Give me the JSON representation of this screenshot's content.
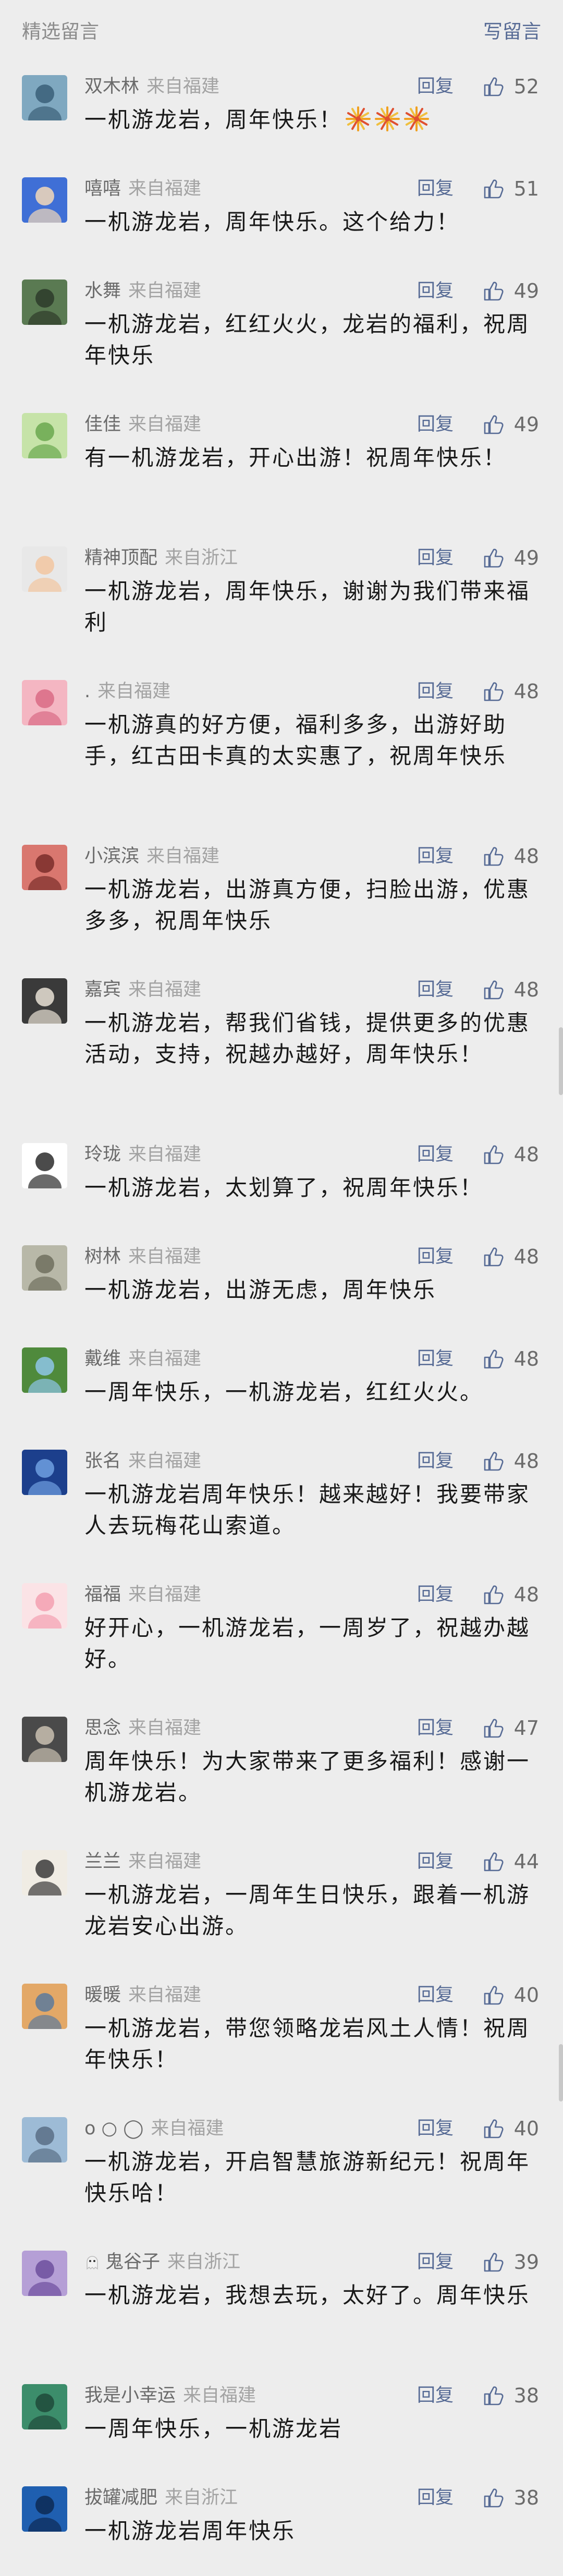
{
  "header": {
    "title": "精选留言",
    "write_label": "写留言"
  },
  "reply_label": "回复",
  "comments": [
    {
      "name": "双木林",
      "location": "来自福建",
      "text": "一机游龙岩，周年快乐！",
      "emoji": "fireworks-emoji x3",
      "likes": "52",
      "avatar_colors": [
        "#7fa8c0",
        "#3a5f78"
      ]
    },
    {
      "name": "嘻嘻",
      "location": "来自福建",
      "text": "一机游龙岩，周年快乐。这个给力！",
      "likes": "51",
      "avatar_colors": [
        "#3f6fd6",
        "#f3d9b8"
      ]
    },
    {
      "name": "水舞",
      "location": "来自福建",
      "text": "一机游龙岩，红红火火，龙岩的福利，祝周年快乐",
      "likes": "49",
      "avatar_colors": [
        "#5a7a52",
        "#2d3b2a"
      ]
    },
    {
      "name": "佳佳",
      "location": "来自福建",
      "text": "有一机游龙岩，开心出游！祝周年快乐！",
      "likes": "49",
      "avatar_colors": [
        "#c6e3a8",
        "#6aa84f"
      ]
    },
    {
      "name": "精神顶配",
      "location": "来自浙江",
      "text": "一机游龙岩，周年快乐，谢谢为我们带来福利",
      "likes": "49",
      "avatar_colors": [
        "#e8e8e8",
        "#f2c6a0"
      ]
    },
    {
      "name": ".",
      "location": "来自福建",
      "text": "一机游真的好方便，福利多多，出游好助手，红古田卡真的太实惠了，祝周年快乐",
      "likes": "48",
      "avatar_colors": [
        "#f4b6c2",
        "#d96b85"
      ]
    },
    {
      "name": "小滨滨",
      "location": "来自福建",
      "text": "一机游龙岩，出游真方便，扫脸出游，优惠多多，祝周年快乐",
      "likes": "48",
      "avatar_colors": [
        "#d9776f",
        "#7a2d2a"
      ]
    },
    {
      "name": "嘉宾",
      "location": "来自福建",
      "text": "一机游龙岩，帮我们省钱，提供更多的优惠活动，支持，祝越办越好，周年快乐！",
      "likes": "48",
      "avatar_colors": [
        "#3a3a3a",
        "#e9e2d6"
      ]
    },
    {
      "name": "玲珑",
      "location": "来自福建",
      "text": "一机游龙岩，太划算了，祝周年快乐！",
      "likes": "48",
      "avatar_colors": [
        "#ffffff",
        "#2b2b2b"
      ]
    },
    {
      "name": "树林",
      "location": "来自福建",
      "text": "一机游龙岩，出游无虑，周年快乐",
      "likes": "48",
      "avatar_colors": [
        "#b8b8a8",
        "#6f6f5e"
      ]
    },
    {
      "name": "戴维",
      "location": "来自福建",
      "text": "一周年快乐，一机游龙岩，红红火火。",
      "likes": "48",
      "avatar_colors": [
        "#4f8a3c",
        "#8ec5e8"
      ]
    },
    {
      "name": "张名",
      "location": "来自福建",
      "text": "一机游龙岩周年快乐！越来越好！我要带家人去玩梅花山索道。",
      "likes": "48",
      "avatar_colors": [
        "#1c3f8c",
        "#6fa0e0"
      ]
    },
    {
      "name": "福福",
      "location": "来自福建",
      "text": "好开心，一机游龙岩，一周岁了，祝越办越好。",
      "likes": "48",
      "avatar_colors": [
        "#fbe3e6",
        "#f3a0b0"
      ]
    },
    {
      "name": "思念",
      "location": "来自福建",
      "text": "周年快乐！为大家带来了更多福利！感谢一机游龙岩。",
      "likes": "47",
      "avatar_colors": [
        "#4a4a4a",
        "#c9c0b0"
      ]
    },
    {
      "name": "兰兰",
      "location": "来自福建",
      "text": "一机游龙岩，一周年生日快乐，跟着一机游龙岩安心出游。",
      "likes": "44",
      "avatar_colors": [
        "#f0ece4",
        "#3b3b3b"
      ]
    },
    {
      "name": "暖暖",
      "location": "来自福建",
      "text": "一机游龙岩，带您领略龙岩风土人情！祝周年快乐！",
      "likes": "40",
      "avatar_colors": [
        "#e3a867",
        "#5c7a9c"
      ]
    },
    {
      "name": "o ○ ◯",
      "location": "来自福建",
      "text": "一机游龙岩，开启智慧旅游新纪元！祝周年快乐哈！",
      "likes": "40",
      "avatar_colors": [
        "#9dbbd6",
        "#5a6f86"
      ]
    },
    {
      "name": "鬼谷子",
      "location": "来自浙江",
      "text": "一机游龙岩，我想去玩，太好了。周年快乐",
      "likes": "39",
      "avatar_colors": [
        "#b59fd6",
        "#6d4f9e"
      ],
      "name_prefix_icon": "ghost-icon"
    },
    {
      "name": "我是小幸运",
      "location": "来自福建",
      "text": "一周年快乐，一机游龙岩",
      "likes": "38",
      "avatar_colors": [
        "#3c8d6b",
        "#1f4a3a"
      ]
    },
    {
      "name": "拔罐减肥",
      "location": "来自浙江",
      "text": "一机游龙岩周年快乐",
      "likes": "38",
      "avatar_colors": [
        "#1f5fb0",
        "#0d2a55"
      ]
    }
  ]
}
